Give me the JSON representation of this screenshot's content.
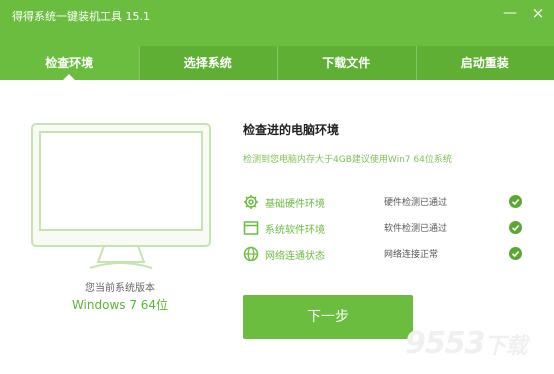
{
  "window": {
    "title": "得得系统一键装机工具 15.1",
    "minimize_glyph": "—",
    "close_glyph": "×"
  },
  "tabs": [
    {
      "label": "检查环境",
      "active": true
    },
    {
      "label": "选择系统",
      "active": false
    },
    {
      "label": "下载文件",
      "active": false
    },
    {
      "label": "启动重装",
      "active": false
    }
  ],
  "monitor": {
    "caption": "您当前系统版本",
    "version": "Windows 7 64位"
  },
  "check": {
    "title": "检查进的电脑环境",
    "description": "检测到您电脑内存大于4GB建议使用Win7 64位系统",
    "items": [
      {
        "icon": "gear-icon",
        "name": "基础硬件环境",
        "status": "硬件检测已通过"
      },
      {
        "icon": "window-icon",
        "name": "系统软件环境",
        "status": "软件检测已通过"
      },
      {
        "icon": "globe-icon",
        "name": "网络连通状态",
        "status": "网络连接正常"
      }
    ]
  },
  "next_button": {
    "label": "下一步"
  },
  "watermark": {
    "text": "9553",
    "suffix": "下载"
  },
  "colors": {
    "accent": "#6bbd3f",
    "tab_bg": "#5faf34",
    "check": "#5aa832"
  }
}
